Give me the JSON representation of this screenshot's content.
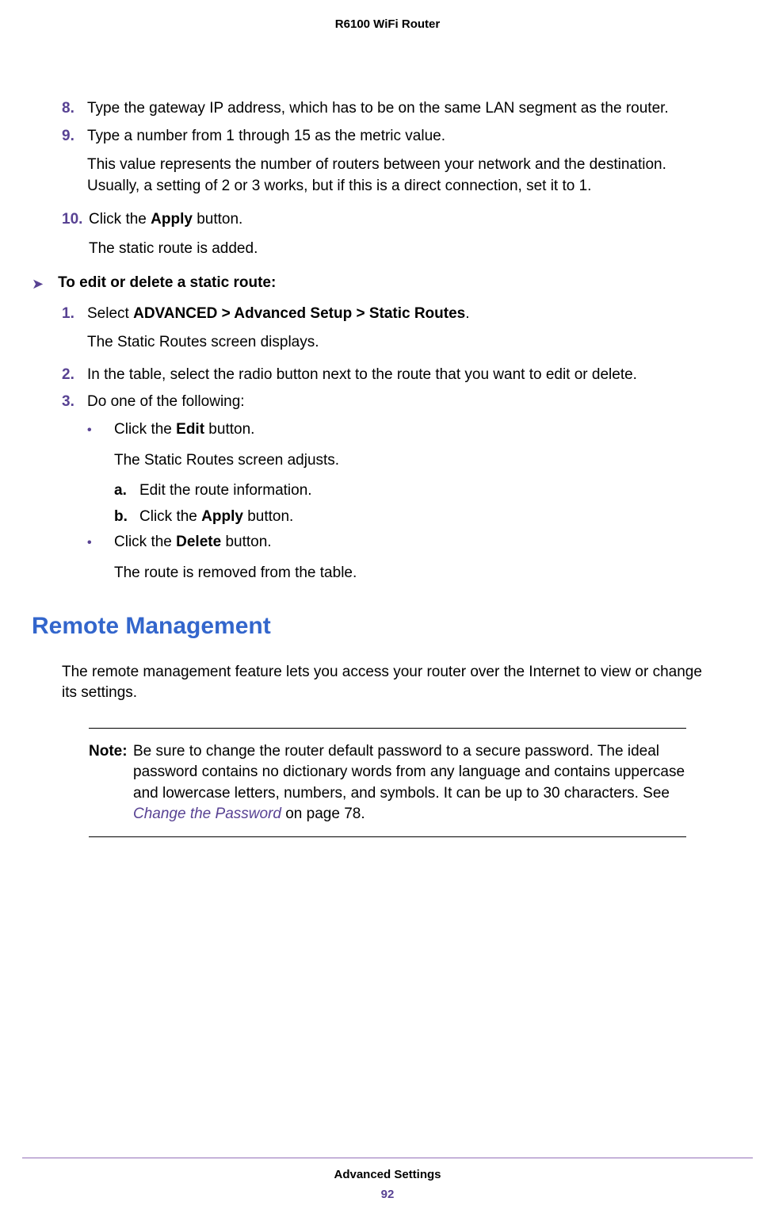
{
  "header": {
    "title": "R6100 WiFi Router"
  },
  "steps_a": {
    "s8": {
      "num": "8.",
      "text": "Type the gateway IP address, which has to be on the same LAN segment as the router."
    },
    "s9": {
      "num": "9.",
      "text": "Type a number from 1 through 15 as the metric value.",
      "para": "This value represents the number of routers between your network and the destination. Usually, a setting of 2 or 3 works, but if this is a direct connection, set it to 1."
    },
    "s10": {
      "num": "10.",
      "pre": "Click the ",
      "bold": "Apply",
      "post": " button.",
      "para": "The static route is added."
    }
  },
  "procedure": {
    "title": "To edit or delete a static route:"
  },
  "steps_b": {
    "s1": {
      "num": "1.",
      "pre": "Select ",
      "bold": "ADVANCED > Advanced Setup > Static Routes",
      "post": ".",
      "para": "The Static Routes screen displays."
    },
    "s2": {
      "num": "2.",
      "text": "In the table, select the radio button next to the route that you want to edit or delete."
    },
    "s3": {
      "num": "3.",
      "text": "Do one of the following:"
    }
  },
  "bullets": {
    "b1": {
      "pre": "Click the ",
      "bold": "Edit",
      "post": " button.",
      "para": "The Static Routes screen adjusts."
    },
    "b2": {
      "pre": "Click the ",
      "bold": "Delete",
      "post": " button.",
      "para": "The route is removed from the table."
    }
  },
  "lettered": {
    "la": {
      "label": "a.",
      "text": "Edit the route information."
    },
    "lb": {
      "label": "b.",
      "pre": "Click the ",
      "bold": "Apply",
      "post": " button."
    }
  },
  "section": {
    "heading": "Remote Management",
    "para": "The remote management feature lets you access your router over the Internet to view or change its settings."
  },
  "note": {
    "label": "Note:",
    "text_pre": "Be sure to change the router default password to a secure password. The ideal password contains no dictionary words from any language and contains uppercase and lowercase letters, numbers, and symbols. It can be up to 30 characters. See ",
    "link": "Change the Password",
    "text_post": " on page 78."
  },
  "footer": {
    "title": "Advanced Settings",
    "page": "92"
  }
}
